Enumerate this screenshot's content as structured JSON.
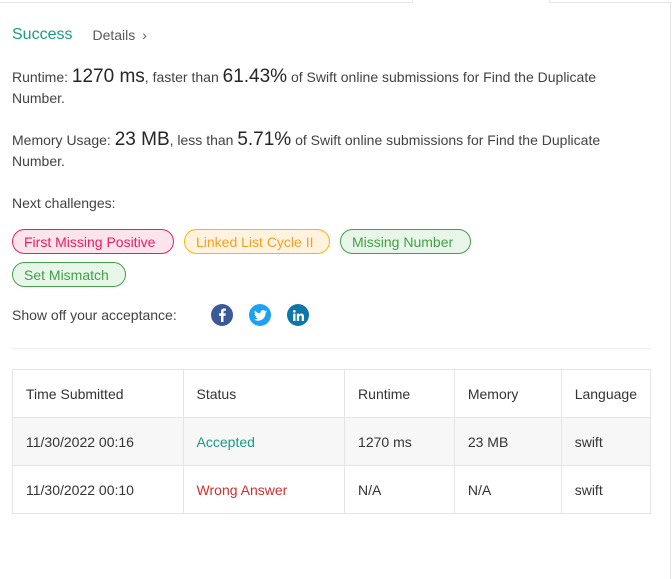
{
  "header": {
    "status": "Success",
    "details_label": "Details",
    "chevron": "›"
  },
  "stats": {
    "runtime_label": "Runtime: ",
    "runtime_value": "1270 ms",
    "runtime_mid": ", faster than ",
    "runtime_percent": "61.43%",
    "runtime_tail": " of Swift online submissions for Find the Duplicate Number.",
    "memory_label": "Memory Usage: ",
    "memory_value": "23 MB",
    "memory_mid": ", less than ",
    "memory_percent": "5.71%",
    "memory_tail": " of Swift online submissions for Find the Duplicate Number."
  },
  "next": {
    "label": "Next challenges:",
    "challenges": [
      {
        "label": "First Missing Positive",
        "difficulty": "hard",
        "color": "#e91e63"
      },
      {
        "label": "Linked List Cycle II",
        "difficulty": "medium",
        "color": "#ffb300"
      },
      {
        "label": "Missing Number",
        "difficulty": "easy",
        "color": "#43a047"
      },
      {
        "label": "Set Mismatch",
        "difficulty": "easy",
        "color": "#43a047"
      }
    ]
  },
  "share": {
    "label": "Show off your acceptance:",
    "icons": [
      "facebook-icon",
      "twitter-icon",
      "linkedin-icon"
    ]
  },
  "table": {
    "headers": [
      "Time Submitted",
      "Status",
      "Runtime",
      "Memory",
      "Language"
    ],
    "rows": [
      {
        "time": "11/30/2022 00:16",
        "status": "Accepted",
        "runtime": "1270 ms",
        "memory": "23 MB",
        "language": "swift"
      },
      {
        "time": "11/30/2022 00:10",
        "status": "Wrong Answer",
        "runtime": "N/A",
        "memory": "N/A",
        "language": "swift"
      }
    ]
  },
  "colors": {
    "accent": "#1a9a84",
    "error": "#d32f2f"
  }
}
